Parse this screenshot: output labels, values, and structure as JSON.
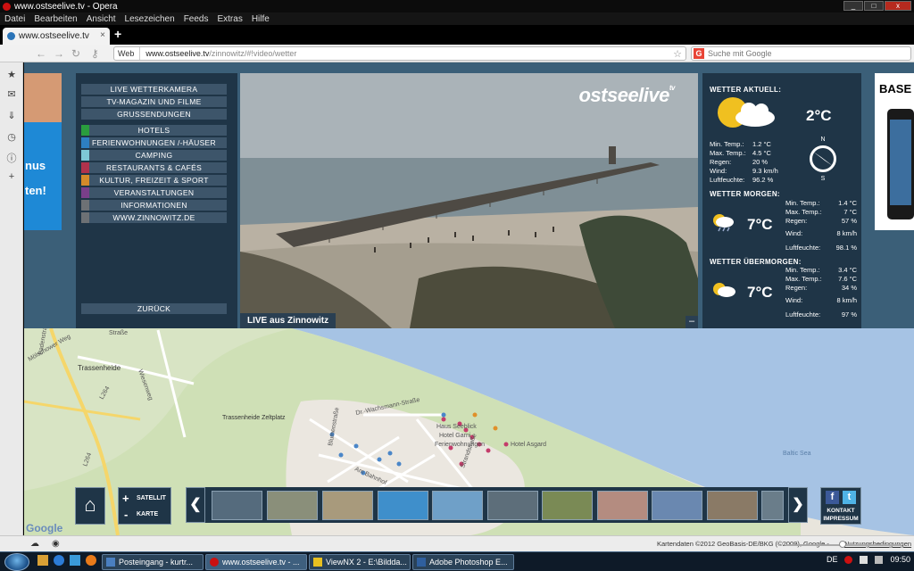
{
  "window": {
    "title": "www.ostseelive.tv - Opera",
    "minimize": "_",
    "maximize": "□",
    "close": "x"
  },
  "menu": [
    "Datei",
    "Bearbeiten",
    "Ansicht",
    "Lesezeichen",
    "Feeds",
    "Extras",
    "Hilfe"
  ],
  "tab": {
    "label": "www.ostseelive.tv",
    "close": "×",
    "new_tab": "+"
  },
  "address": {
    "badge": "Web",
    "url_host": "www.ostseelive.tv",
    "url_path": "/zinnowitz/#!video/wetter",
    "star": "☆"
  },
  "search": {
    "engine": "G",
    "placeholder": "Suche mit Google"
  },
  "nav": {
    "back": "←",
    "forward": "→",
    "reload": "↻",
    "key": "⚷"
  },
  "sidebar_icons": [
    "star-icon",
    "mail-icon",
    "download-icon",
    "history-icon",
    "info-icon",
    "add-icon"
  ],
  "ad_left": {
    "line1": "nus",
    "line2": "ten!"
  },
  "ad_right": {
    "text": "BASE"
  },
  "left_menu": {
    "top_items": [
      "LIVE WETTERKAMERA",
      "TV-MAGAZIN UND FILME",
      "GRUSSENDUNGEN"
    ],
    "items": [
      {
        "label": "HOTELS",
        "color": "#2a9d3e"
      },
      {
        "label": "FERIENWOHNUNGEN /-HÄUSER",
        "color": "#2d7fc1"
      },
      {
        "label": "CAMPING",
        "color": "#7ec8d6"
      },
      {
        "label": "RESTAURANTS & CAFÉS",
        "color": "#b0324c"
      },
      {
        "label": "KULTUR, FREIZEIT & SPORT",
        "color": "#d48a2a"
      },
      {
        "label": "VERANSTALTUNGEN",
        "color": "#7a3f8a"
      },
      {
        "label": "INFORMATIONEN",
        "color": "#6d7175"
      },
      {
        "label": "WWW.ZINNOWITZ.DE",
        "color": "#6d7175"
      }
    ],
    "back": "ZURÜCK"
  },
  "video": {
    "logo": "ostseelive",
    "logo_tv": "tv",
    "caption": "LIVE aus Zinnowitz",
    "minimize": "–"
  },
  "weather": {
    "current": {
      "heading": "WETTER AKTUELL:",
      "temp": "2°C",
      "rows": [
        [
          "Min. Temp.:",
          "1.2 °C"
        ],
        [
          "Max. Temp.:",
          "4.5 °C"
        ],
        [
          "Regen:",
          "20 %"
        ],
        [
          "Wind:",
          "9.3 km/h"
        ],
        [
          "Luftfeuchte:",
          "96.2 %"
        ]
      ],
      "compass": {
        "n": "N",
        "s": "S"
      }
    },
    "tomorrow": {
      "heading": "WETTER MORGEN:",
      "temp": "7°C",
      "rows": [
        [
          "Min. Temp.:",
          "1.4 °C"
        ],
        [
          "Max. Temp.:",
          "7 °C"
        ],
        [
          "Regen:",
          "57 %"
        ],
        [
          "Wind:",
          "8 km/h"
        ],
        [
          "Luftfeuchte:",
          "98.1 %"
        ]
      ]
    },
    "day_after": {
      "heading": "WETTER ÜBERMORGEN:",
      "temp": "7°C",
      "rows": [
        [
          "Min. Temp.:",
          "3.4 °C"
        ],
        [
          "Max. Temp.:",
          "7.6 °C"
        ],
        [
          "Regen:",
          "34 %"
        ],
        [
          "Wind:",
          "8 km/h"
        ],
        [
          "Luftfeuchte:",
          "97 %"
        ]
      ]
    }
  },
  "map": {
    "labels": [
      "Mölschower Weg",
      "Trassenheide",
      "L264",
      "Trassenheide Zeltplatz",
      "Baltic Sea",
      "Hotel Asgard",
      "Haus Seeblick",
      "Hotel Garni",
      "Ferienwohnungen",
      "Am Bahnhof",
      "Dr.-Wachsmann-Straße",
      "Strandstraße",
      "Wiesenweg",
      "L264",
      "Badenstraße",
      "Straße",
      "Blumenstraße"
    ],
    "google": "Google",
    "attribution": "Kartendaten ©2012 GeoBasis-DE/BKG (©2009), Google -",
    "terms": "Nutzungsbedingungen"
  },
  "controls": {
    "home": "⌂",
    "plus": "+",
    "minus": "-",
    "satellit": "SATELLIT",
    "karte": "KARTE",
    "prev": "❮",
    "next": "❯",
    "kontakt": "KONTAKT",
    "impressum": "IMPRESSUM",
    "fb": "f",
    "tw": "t"
  },
  "thumbs": [
    "#556b7d",
    "#8a8f7a",
    "#a89a7c",
    "#3f8fcb",
    "#6fa0c8",
    "#5d6e7a",
    "#7a8a55",
    "#b48c80",
    "#6a88b0",
    "#8a7a66",
    "#6a7d8a"
  ],
  "taskbar": {
    "items": [
      "Posteingang - kurtr...",
      "www.ostseelive.tv - ...",
      "ViewNX 2 - E:\\Bildda...",
      "Adobe Photoshop E..."
    ],
    "lang": "DE",
    "time": "09:50"
  }
}
